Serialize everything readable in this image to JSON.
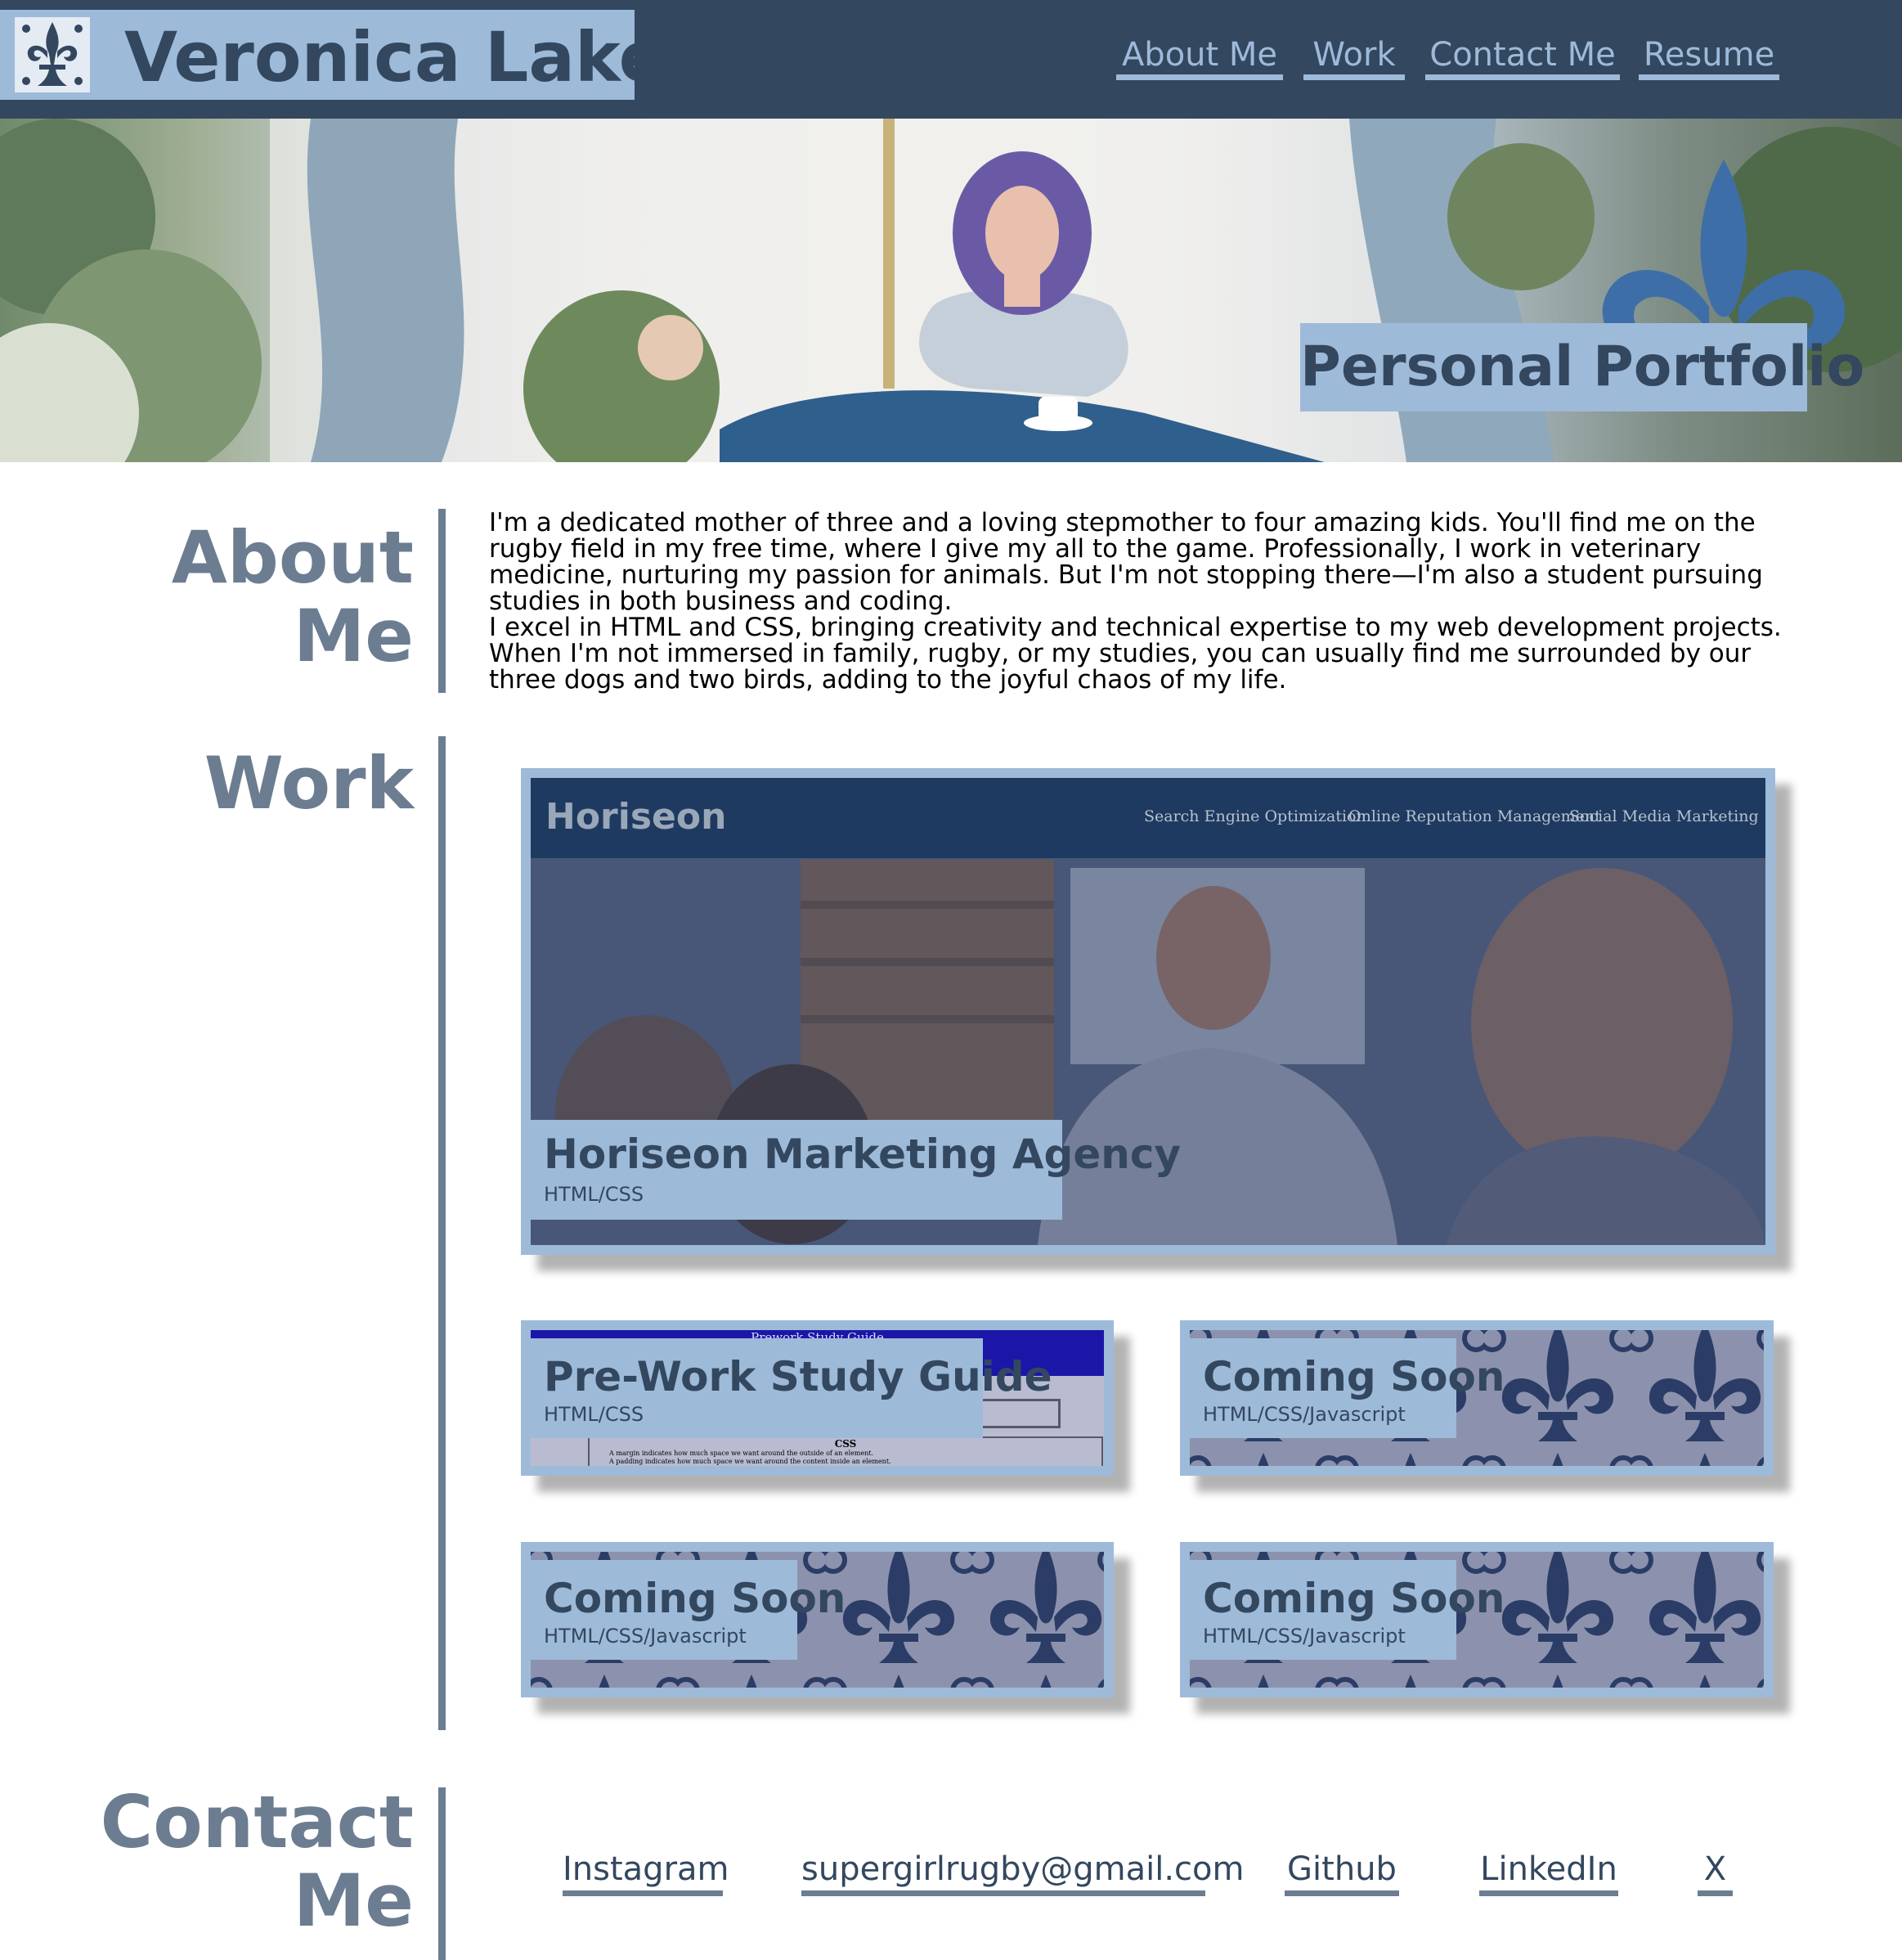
{
  "header": {
    "name": "Veronica Lake",
    "logo_icon": "fleur-de-lis-icon",
    "nav": [
      {
        "label": "About Me"
      },
      {
        "label": "Work"
      },
      {
        "label": "Contact Me"
      },
      {
        "label": "Resume"
      }
    ]
  },
  "hero": {
    "title": "Personal Portfolio"
  },
  "about": {
    "heading_line1": "About",
    "heading_line2": "Me",
    "paragraphs": [
      "I'm a dedicated mother of three and a loving stepmother to four amazing kids. You'll find me on the rugby field in my free time, where I give my all to the game. Professionally, I work in veterinary medicine, nurturing my passion for animals. But I'm not stopping there—I'm also a student pursuing studies in both business and coding.",
      "I excel in HTML and CSS, bringing creativity and technical expertise to my web development projects. When I'm not immersed in family, rugby, or my studies, you can usually find me surrounded by our three dogs and two birds, adding to the joyful chaos of my life."
    ]
  },
  "work": {
    "heading": "Work",
    "featured": {
      "title": "Horiseon Marketing Agency",
      "tech": "HTML/CSS",
      "preview": {
        "brand": "Horiseon",
        "nav": [
          "Search Engine Optimization",
          "Online Reputation Management",
          "Social Media Marketing"
        ]
      }
    },
    "projects": [
      {
        "title": "Pre-Work Study Guide",
        "tech": "HTML/CSS",
        "preview": {
          "header": "Prework Study Guide",
          "section": "CSS",
          "lines": [
            "A margin indicates how much space we want around the outside of an element.",
            "A padding indicates how much space we want around the content inside an element."
          ]
        }
      },
      {
        "title": "Coming Soon",
        "tech": "HTML/CSS/Javascript"
      },
      {
        "title": "Coming Soon",
        "tech": "HTML/CSS/Javascript"
      },
      {
        "title": "Coming Soon",
        "tech": "HTML/CSS/Javascript"
      }
    ]
  },
  "contact": {
    "heading_line1": "Contact",
    "heading_line2": "Me",
    "links": [
      {
        "label": "Instagram"
      },
      {
        "label": "supergirlrugby@gmail.com"
      },
      {
        "label": "Github"
      },
      {
        "label": "LinkedIn"
      },
      {
        "label": "X"
      }
    ]
  },
  "colors": {
    "navy": "#33475f",
    "light_blue": "#9ebad9",
    "slate": "#6c7d91"
  }
}
